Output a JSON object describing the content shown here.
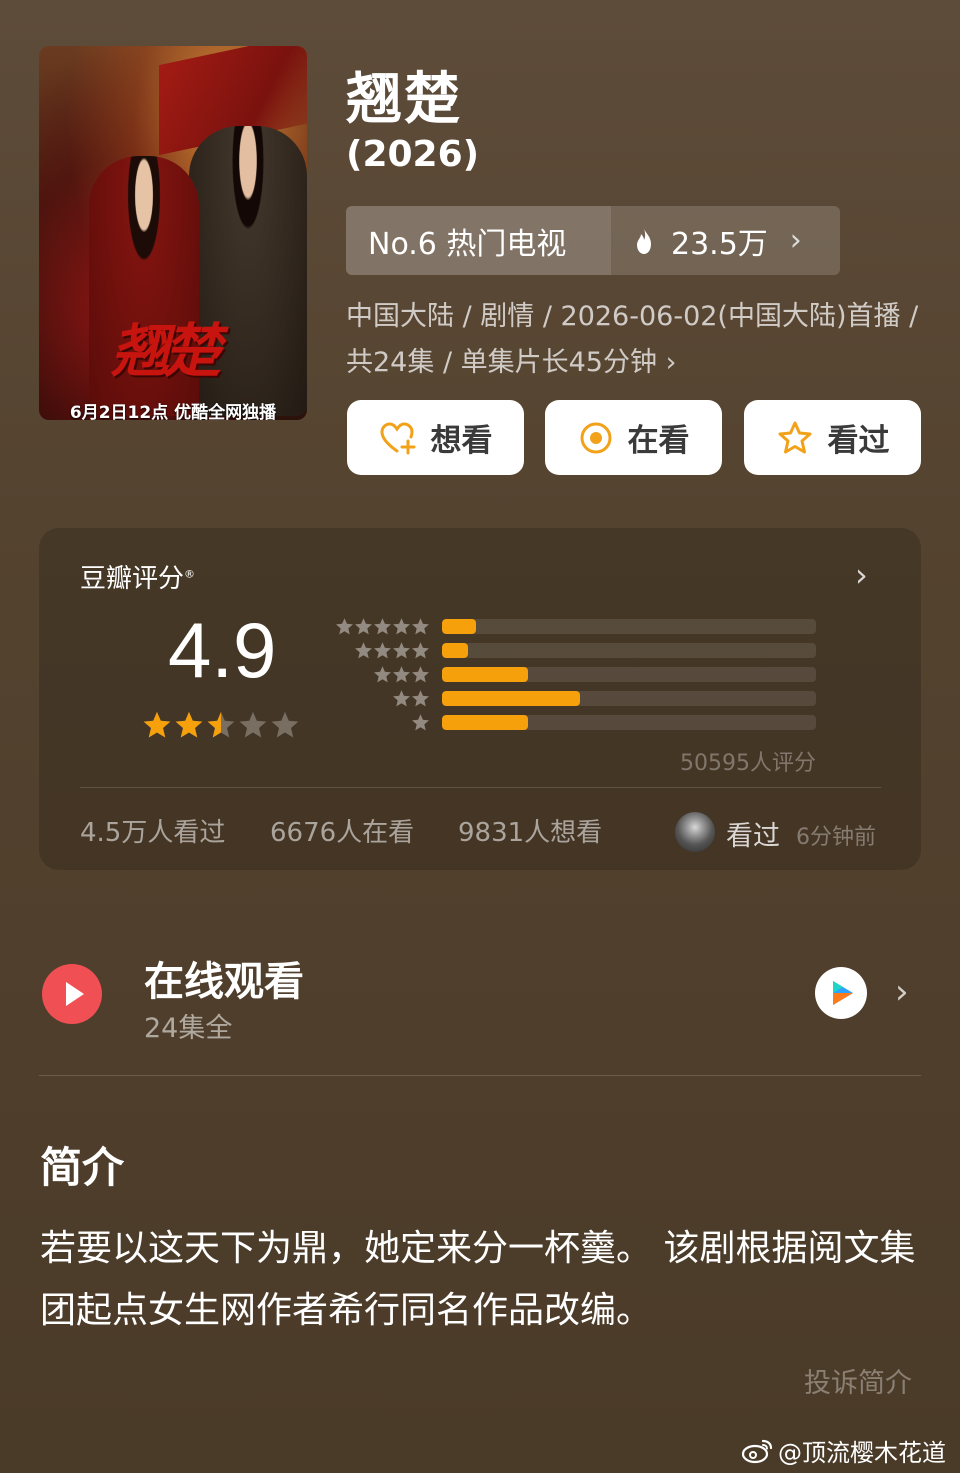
{
  "poster": {
    "calligraphy": "翘楚",
    "caption": "6月2日12点 优酷全网独播"
  },
  "title": "翘楚",
  "year": "(2026)",
  "rank": {
    "label": "No.6 热门电视",
    "heat": "23.5万",
    "fire_icon": "fire-icon"
  },
  "meta": "中国大陆 / 剧情 / 2026-06-02(中国大陆)首播 / 共24集 / 单集片长45分钟",
  "meta_chevron": "›",
  "actions": [
    {
      "label": "想看",
      "icon": "heart-plus-icon"
    },
    {
      "label": "在看",
      "icon": "target-icon"
    },
    {
      "label": "看过",
      "icon": "star-outline-icon"
    }
  ],
  "rating": {
    "title": "豆瓣评分",
    "registered": "®",
    "score": "4.9",
    "stars_value": 2.5,
    "distribution": [
      {
        "stars": 5,
        "fraction": 0.09
      },
      {
        "stars": 4,
        "fraction": 0.07
      },
      {
        "stars": 3,
        "fraction": 0.23
      },
      {
        "stars": 2,
        "fraction": 0.37
      },
      {
        "stars": 1,
        "fraction": 0.23
      }
    ],
    "count": "50595人评分",
    "stats": {
      "seen": "4.5万人看过",
      "watching": "6676人在看",
      "want": "9831人想看"
    },
    "friend": {
      "action": "看过",
      "time": "6分钟前"
    }
  },
  "watch": {
    "title": "在线观看",
    "subtitle": "24集全"
  },
  "intro": {
    "title": "简介",
    "text": "若要以这天下为鼎，她定来分一杯羹。 该剧根据阅文集团起点女生网作者希行同名作品改编。",
    "report": "投诉简介"
  },
  "watermark": "@顶流樱木花道",
  "colors": {
    "accent": "#f6a00c",
    "play": "#f04f54",
    "background": "#54432f"
  }
}
